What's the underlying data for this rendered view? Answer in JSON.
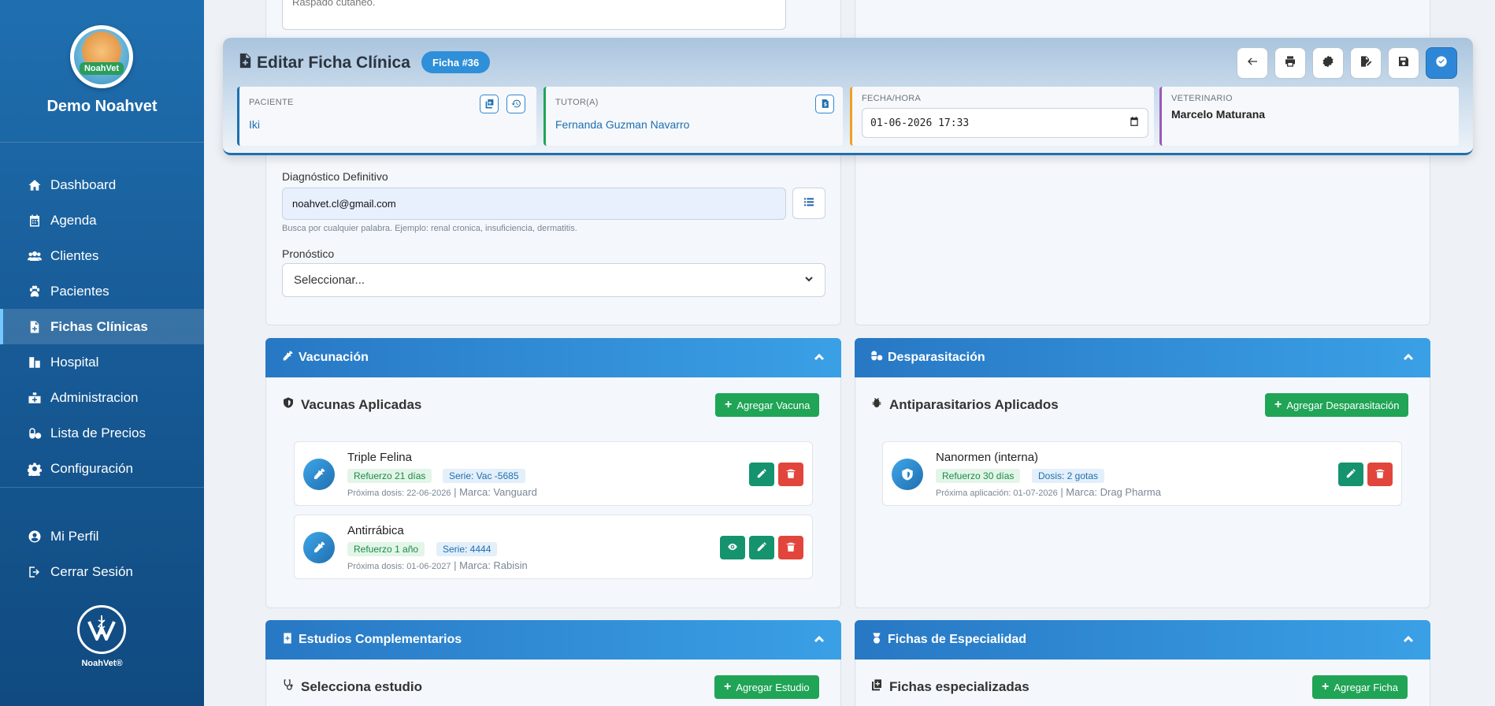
{
  "sidebar": {
    "brand": "Demo Noahvet",
    "logo_text": "NoahVet",
    "items": [
      {
        "label": "Dashboard",
        "icon": "home-icon"
      },
      {
        "label": "Agenda",
        "icon": "calendar-icon"
      },
      {
        "label": "Clientes",
        "icon": "users-icon"
      },
      {
        "label": "Pacientes",
        "icon": "paw-icon"
      },
      {
        "label": "Fichas Clínicas",
        "icon": "file-medical-icon"
      },
      {
        "label": "Hospital",
        "icon": "hospital-icon"
      },
      {
        "label": "Administracion",
        "icon": "admin-icon"
      },
      {
        "label": "Lista de Precios",
        "icon": "pills-icon"
      },
      {
        "label": "Configuración",
        "icon": "gear-icon"
      }
    ],
    "profile": "Mi Perfil",
    "logout": "Cerrar Sesión",
    "footer_name": "NoahVet®"
  },
  "header": {
    "title": "Editar Ficha Clínica",
    "badge": "Ficha #36",
    "paciente_label": "PACIENTE",
    "paciente_value": "Iki",
    "tutor_label": "TUTOR(A)",
    "tutor_value": "Fernanda Guzman Navarro",
    "fecha_label": "FECHA/HORA",
    "fecha_value": "01-06-2026 17:33",
    "vet_label": "VETERINARIO",
    "vet_value": "Marcelo Maturana"
  },
  "form": {
    "textarea_value": "Raspado cutáneo.",
    "diagnostico_label": "Diagnóstico Definitivo",
    "diagnostico_value": "noahvet.cl@gmail.com",
    "diagnostico_hint": "Busca por cualquier palabra. Ejemplo: renal cronica, insuficiencia, dermatitis.",
    "pronostico_label": "Pronóstico",
    "pronostico_value": "Seleccionar..."
  },
  "vacunacion": {
    "title": "Vacunación",
    "subtitle": "Vacunas Aplicadas",
    "add_label": "Agregar Vacuna",
    "items": [
      {
        "name": "Triple Felina",
        "badge1": "Refuerzo 21 días",
        "badge2": "Serie: Vac -5685",
        "meta_date": "Próxima dosis: 22-06-2026",
        "meta_brand": " | Marca: Vanguard"
      },
      {
        "name": "Antirrábica",
        "badge1": "Refuerzo 1 año",
        "badge2": "Serie: 4444",
        "meta_date": "Próxima dosis: 01-06-2027",
        "meta_brand": " | Marca: Rabisin"
      }
    ]
  },
  "desparasitacion": {
    "title": "Desparasitación",
    "subtitle": "Antiparasitarios Aplicados",
    "add_label": "Agregar Desparasitación",
    "items": [
      {
        "name": "Nanormen (interna)",
        "badge1": "Refuerzo 30 días",
        "badge2": "Dosis: 2 gotas",
        "meta_date": "Próxima aplicación: 01-07-2026",
        "meta_brand": " | Marca: Drag Pharma"
      }
    ]
  },
  "estudios": {
    "title": "Estudios Complementarios",
    "subtitle": "Selecciona estudio",
    "add_label": "Agregar Estudio"
  },
  "especialidad": {
    "title": "Fichas de Especialidad",
    "subtitle": "Fichas especializadas",
    "add_label": "Agregar Ficha"
  },
  "colors": {
    "accent": "#1f6fb0",
    "green": "#20a456",
    "red": "#e2453b"
  }
}
